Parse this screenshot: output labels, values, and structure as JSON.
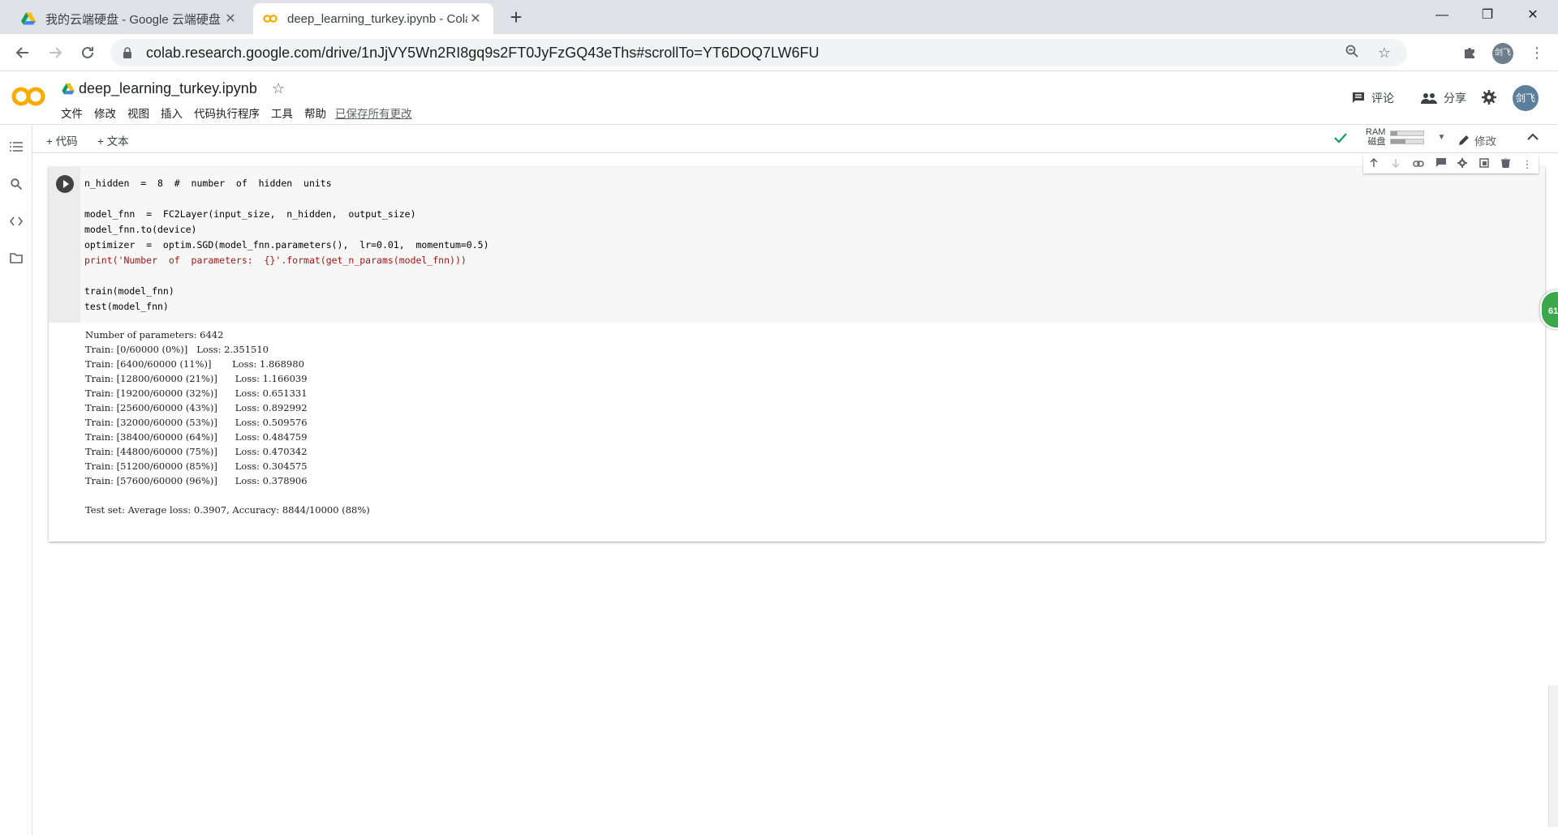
{
  "browser": {
    "tabs": [
      {
        "title": "我的云端硬盘 - Google 云端硬盘",
        "close": "✕"
      },
      {
        "title": "deep_learning_turkey.ipynb - Colaboratory",
        "close": "✕"
      }
    ],
    "new_tab": "+",
    "url": "colab.research.google.com/drive/1nJjVY5Wn2RI8gq9s2FT0JyFzGQ43eThs#scrollTo=YT6DOQ7LW6FU",
    "profile_label": "剑飞",
    "window_buttons": [
      "—",
      "❐",
      "✕"
    ]
  },
  "colab": {
    "notebook_title": "deep_learning_turkey.ipynb",
    "menu": [
      "文件",
      "修改",
      "视图",
      "插入",
      "代码执行程序",
      "工具",
      "帮助"
    ],
    "saved_status": "已保存所有更改",
    "comment_label": "评论",
    "share_label": "分享",
    "avatar_label": "剑飞",
    "add_code_label": "+ 代码",
    "add_text_label": "+ 文本",
    "ram_label": "RAM",
    "disk_label": "磁盘",
    "ram_fill": 0.2,
    "disk_fill": 0.45,
    "edit_label": "修改",
    "float_badge": "61"
  },
  "cell": {
    "code_lines": [
      "n_hidden  =  8  #  number  of  hidden  units",
      "",
      "model_fnn  =  FC2Layer(input_size,  n_hidden,  output_size)",
      "model_fnn.to(device)",
      "optimizer  =  optim.SGD(model_fnn.parameters(),  lr=0.01,  momentum=0.5)",
      "print('Number  of  parameters:  {}'.format(get_n_params(model_fnn)))",
      "",
      "train(model_fnn)",
      "test(model_fnn)"
    ],
    "output_lines": [
      "Number of parameters: 6442",
      "Train: [0/60000 (0%)]   Loss: 2.351510",
      "Train: [6400/60000 (11%)]       Loss: 1.868980",
      "Train: [12800/60000 (21%)]      Loss: 1.166039",
      "Train: [19200/60000 (32%)]      Loss: 0.651331",
      "Train: [25600/60000 (43%)]      Loss: 0.892992",
      "Train: [32000/60000 (53%)]      Loss: 0.509576",
      "Train: [38400/60000 (64%)]      Loss: 0.484759",
      "Train: [44800/60000 (75%)]      Loss: 0.470342",
      "Train: [51200/60000 (85%)]      Loss: 0.304575",
      "Train: [57600/60000 (96%)]      Loss: 0.378906",
      "",
      "Test set: Average loss: 0.3907, Accuracy: 8844/10000 (88%)"
    ]
  },
  "colors": {
    "colab_orange": "#f9ab00",
    "drive_green": "#0f9d58",
    "accent_green": "#3aa84a"
  }
}
